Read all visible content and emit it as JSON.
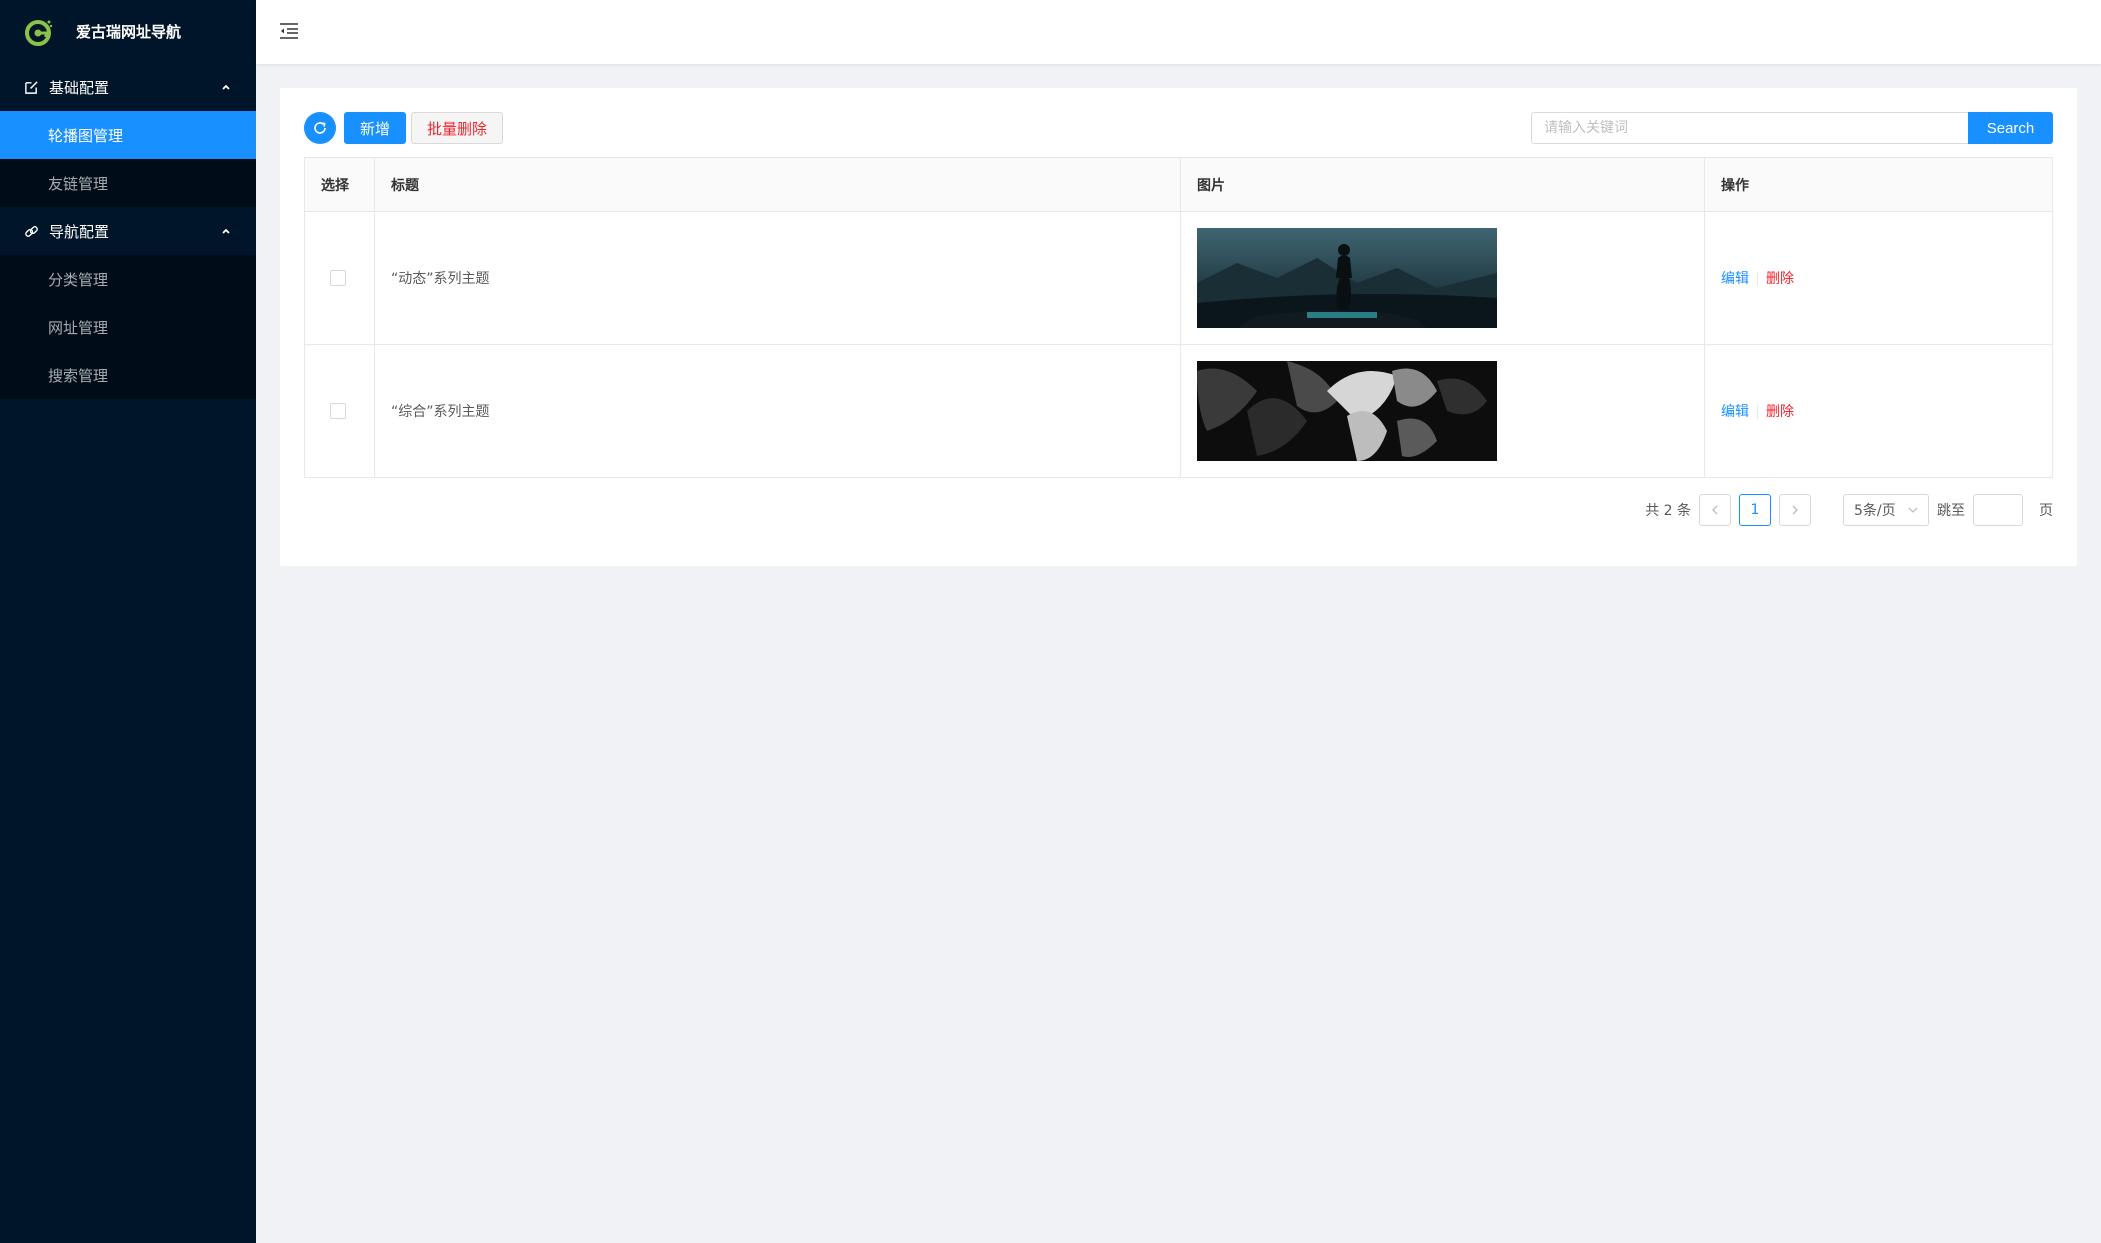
{
  "brand": {
    "title": "爱古瑞网址导航",
    "logo_icon": "brand-g-logo-icon",
    "logo_color": "#8bc34a"
  },
  "sidebar": {
    "groups": [
      {
        "label": "基础配置",
        "icon": "edit-icon",
        "expanded": true,
        "items": [
          {
            "label": "轮播图管理",
            "active": true
          },
          {
            "label": "友链管理",
            "active": false
          }
        ]
      },
      {
        "label": "导航配置",
        "icon": "link-icon",
        "expanded": true,
        "items": [
          {
            "label": "分类管理",
            "active": false
          },
          {
            "label": "网址管理",
            "active": false
          },
          {
            "label": "搜索管理",
            "active": false
          }
        ]
      }
    ]
  },
  "header": {
    "fold_icon": "menu-fold-icon"
  },
  "toolbar": {
    "refresh_icon": "refresh-icon",
    "add_label": "新增",
    "batch_delete_label": "批量删除",
    "search_placeholder": "请输入关键词",
    "search_value": "",
    "search_label": "Search"
  },
  "table": {
    "columns": [
      "选择",
      "标题",
      "图片",
      "操作"
    ],
    "rows": [
      {
        "checked": false,
        "title": "“动态”系列主题",
        "image": "dark teal landscape photo with figure on car",
        "edit_label": "编辑",
        "delete_label": "删除"
      },
      {
        "checked": false,
        "title": "“综合”系列主题",
        "image": "black and white photo of figure with large leaves",
        "edit_label": "编辑",
        "delete_label": "删除"
      }
    ]
  },
  "pagination": {
    "total_text": "共 2 条",
    "current_page": "1",
    "page_size_label": "5条/页",
    "jump_label": "跳至",
    "page_suffix": "页",
    "jump_value": ""
  },
  "colors": {
    "primary": "#1890ff",
    "danger": "#f5222d",
    "sidebar_bg": "#001529",
    "submenu_bg": "#000c17"
  }
}
